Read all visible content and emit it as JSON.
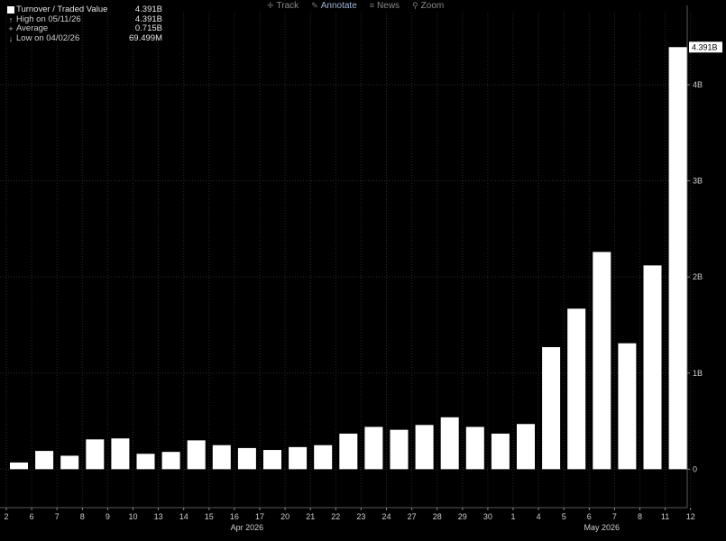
{
  "toolbar": {
    "items": [
      {
        "label": "Track",
        "icon": "crosshair-icon"
      },
      {
        "label": "Annotate",
        "icon": "pencil-icon"
      },
      {
        "label": "News",
        "icon": "news-icon"
      },
      {
        "label": "Zoom",
        "icon": "magnifier-icon"
      }
    ]
  },
  "legend": {
    "series_name": "Turnover / Traded Value",
    "series_value": "4.391B",
    "high_label": "High on 05/11/26",
    "high_value": "4.391B",
    "avg_label": "Average",
    "avg_value": "0.715B",
    "low_label": "Low on 04/02/26",
    "low_value": "69.499M"
  },
  "colors": {
    "background": "#000000",
    "bar": "#ffffff",
    "grid": "#2a2a2a",
    "text": "#cfcfcf"
  },
  "chart_data": {
    "type": "bar",
    "title": "",
    "xlabel": "",
    "ylabel": "",
    "categories": [
      "2",
      "6",
      "7",
      "8",
      "9",
      "10",
      "13",
      "14",
      "15",
      "16",
      "17",
      "20",
      "21",
      "22",
      "23",
      "24",
      "27",
      "28",
      "29",
      "30",
      "1",
      "4",
      "5",
      "6",
      "7",
      "8",
      "11"
    ],
    "extra_tick": "12",
    "months": [
      {
        "label": "Apr 2026",
        "at_index": 9
      },
      {
        "label": "May 2026",
        "at_index": 23
      }
    ],
    "series": [
      {
        "name": "Turnover / Traded Value",
        "values": [
          0.0695,
          0.19,
          0.14,
          0.31,
          0.32,
          0.16,
          0.18,
          0.3,
          0.25,
          0.22,
          0.2,
          0.23,
          0.25,
          0.37,
          0.44,
          0.41,
          0.46,
          0.54,
          0.44,
          0.37,
          0.47,
          1.27,
          1.67,
          2.26,
          1.31,
          2.12,
          4.391
        ]
      }
    ],
    "unit": "B",
    "ylim": [
      -0.4,
      4.75
    ],
    "yticks": [
      {
        "value": 0,
        "label": "0"
      },
      {
        "value": 1,
        "label": "1B"
      },
      {
        "value": 2,
        "label": "2B"
      },
      {
        "value": 3,
        "label": "3B"
      },
      {
        "value": 4,
        "label": "4B"
      }
    ],
    "last_value_label": "4.391B",
    "grid": true
  }
}
